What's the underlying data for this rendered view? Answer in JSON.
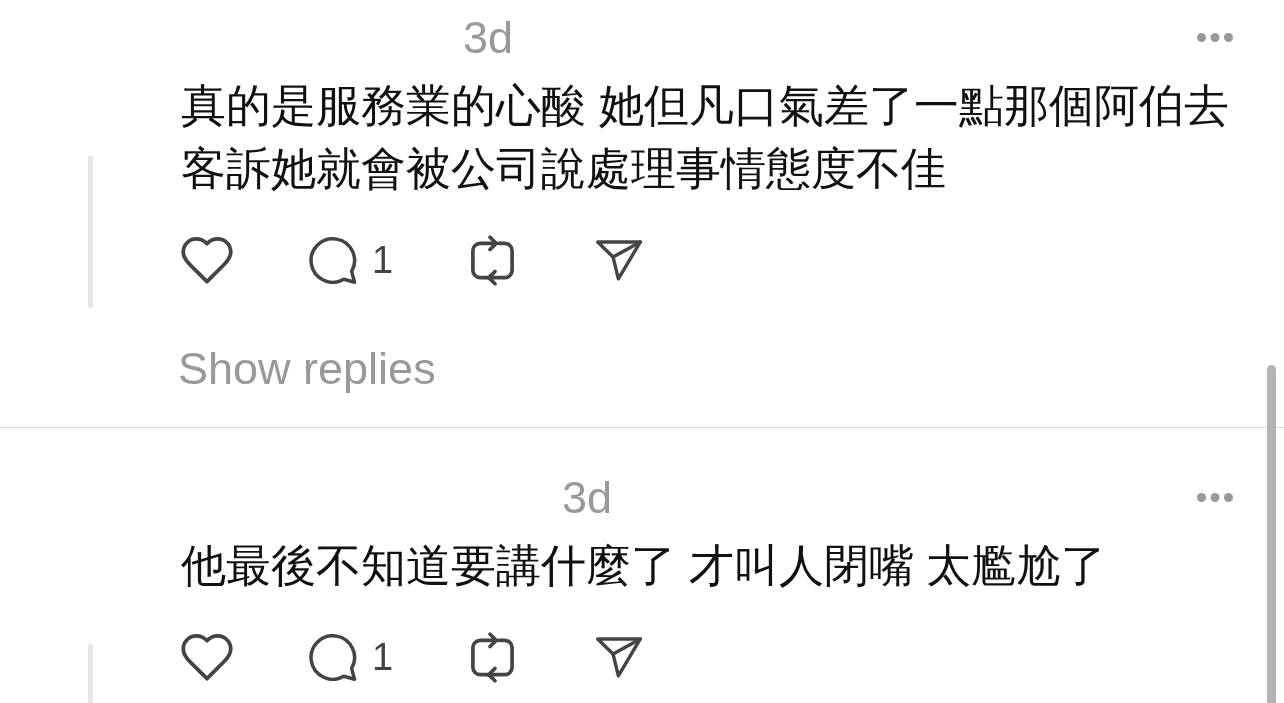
{
  "comments": [
    {
      "time": "3d",
      "text": "真的是服務業的心酸 她但凡口氣差了一點那個阿伯去客訴她就會被公司說處理事情態度不佳",
      "reply_count": "1",
      "show_replies": "Show replies"
    },
    {
      "time": "3d",
      "text": "他最後不知道要講什麼了 才叫人閉嘴 太尷尬了",
      "reply_count": "1"
    }
  ]
}
